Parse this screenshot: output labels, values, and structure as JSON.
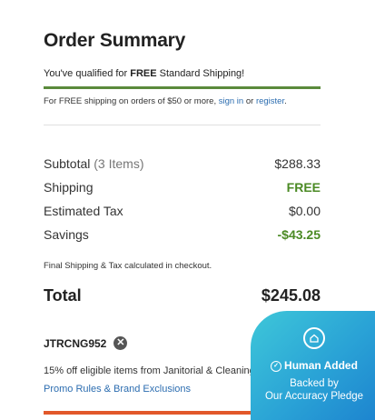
{
  "summary": {
    "title": "Order Summary",
    "qualified_prefix": "You've qualified for ",
    "qualified_bold": "FREE",
    "qualified_suffix": " Standard Shipping!",
    "free_shipping_prefix": "For FREE shipping on orders of $50 or more, ",
    "sign_in": "sign in",
    "or": " or ",
    "register": "register",
    "period": ".",
    "rows": [
      {
        "label": "Subtotal",
        "extra": "(3 Items)",
        "value": "$288.33"
      },
      {
        "label": "Shipping",
        "value": "FREE"
      },
      {
        "label": "Estimated Tax",
        "value": "$0.00"
      },
      {
        "label": "Savings",
        "value": "-$43.25"
      }
    ],
    "calc_note": "Final Shipping & Tax calculated in checkout.",
    "total_label": "Total",
    "total_value": "$245.08"
  },
  "promo": {
    "code": "JTRCNG952",
    "description": "15% off eligible items from Janitorial & Cleaning Supplies",
    "link": "Promo Rules & Brand Exclusions"
  },
  "badge": {
    "line1": "Human Added",
    "line2": "Backed by",
    "line3": "Our Accuracy Pledge"
  },
  "colors": {
    "accent_green": "#4b8a24",
    "link_blue": "#2c6db0",
    "badge_cyan": "#2aa3d6",
    "button_orange": "#e2582a"
  }
}
